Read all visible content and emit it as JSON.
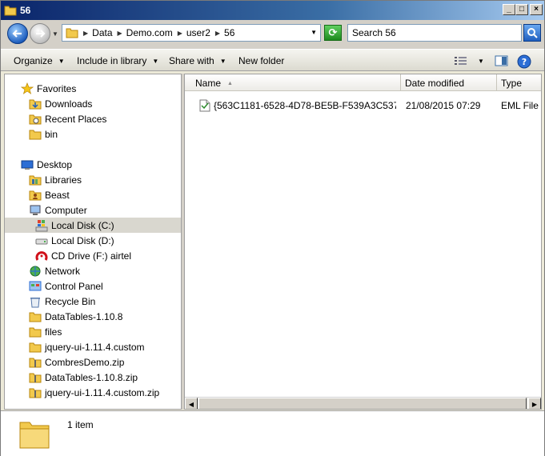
{
  "window": {
    "title": "56"
  },
  "title_buttons": {
    "minimize": "_",
    "maximize": "□",
    "close": "×"
  },
  "address": {
    "crumbs": [
      "Data",
      "Demo.com",
      "user2",
      "56"
    ],
    "search_placeholder": "Search 56"
  },
  "toolbar": {
    "organize": "Organize",
    "include": "Include in library",
    "share": "Share with",
    "new_folder": "New folder"
  },
  "nav": {
    "favorites": "Favorites",
    "downloads": "Downloads",
    "recent": "Recent Places",
    "bin": "bin",
    "desktop": "Desktop",
    "libraries": "Libraries",
    "beast": "Beast",
    "computer": "Computer",
    "local_c": "Local Disk (C:)",
    "local_d": "Local Disk (D:)",
    "cd_drive": "CD Drive (F:) airtel",
    "network": "Network",
    "control_panel": "Control Panel",
    "recycle_bin": "Recycle Bin",
    "datatables": "DataTables-1.10.8",
    "files": "files",
    "jquery_ui": "jquery-ui-1.11.4.custom",
    "combres_zip": "CombresDemo.zip",
    "datatables_zip": "DataTables-1.10.8.zip",
    "jquery_ui_zip": "jquery-ui-1.11.4.custom.zip"
  },
  "columns": {
    "name": "Name",
    "date": "Date modified",
    "type": "Type"
  },
  "files": [
    {
      "name": "{563C1181-6528-4D78-BE5B-F539A3C537D...",
      "date": "21/08/2015 07:29",
      "type": "EML File"
    }
  ],
  "status": {
    "count": "1 item"
  },
  "colors": {
    "folder": "#f2c94c",
    "selected": "#d9d7cf",
    "title_start": "#0a246a"
  }
}
